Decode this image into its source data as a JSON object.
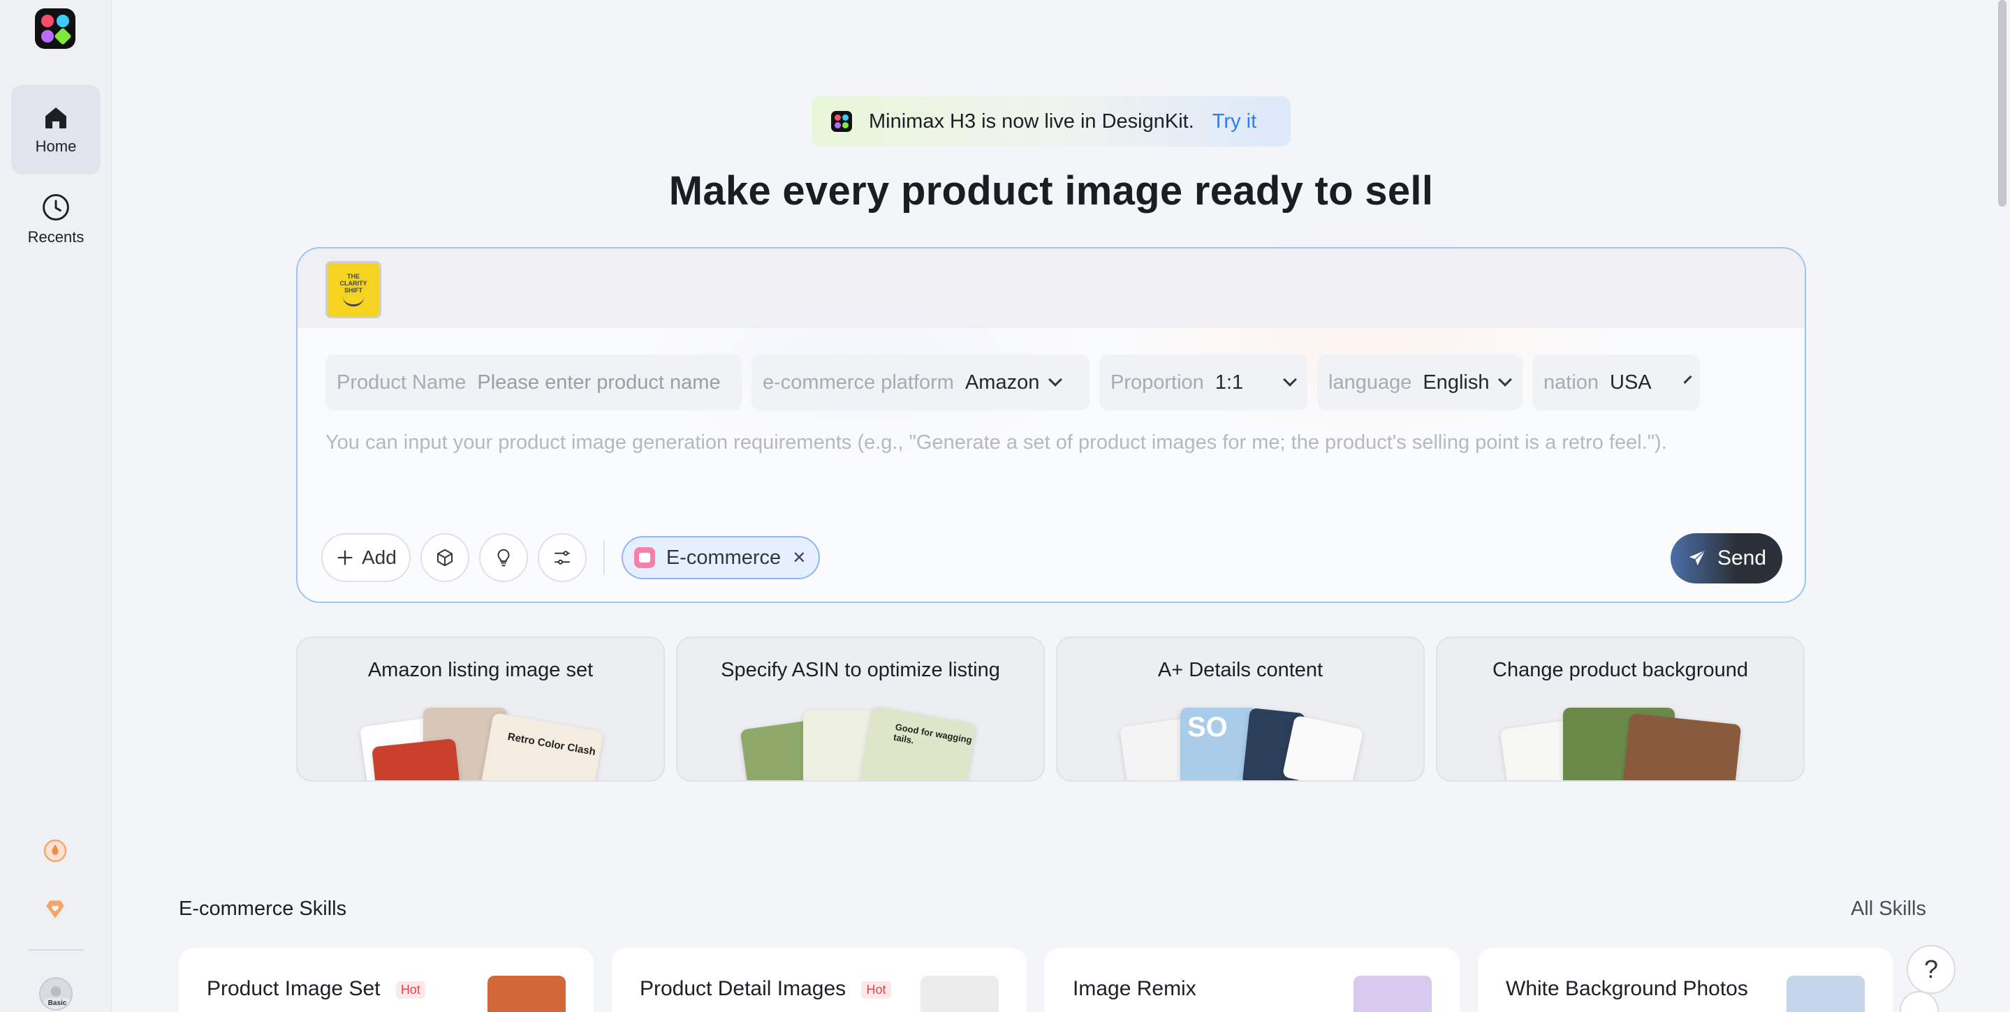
{
  "nav": {
    "home": "Home",
    "recents": "Recents",
    "avatar_badge": "Basic"
  },
  "banner": {
    "text": "Minimax H3 is now live in DesignKit.",
    "link": "Try it"
  },
  "headline": "Make every product image ready to sell",
  "card": {
    "thumbnail_text": "THE CLARITY SHIFT",
    "fields": {
      "product_name_label": "Product Name",
      "product_name_placeholder": "Please enter product name",
      "platform_label": "e-commerce platform",
      "platform_value": "Amazon",
      "proportion_label": "Proportion",
      "proportion_value": "1:1",
      "language_label": "language",
      "language_value": "English",
      "nation_label": "nation",
      "nation_value": "USA"
    },
    "requirements_placeholder": "You can input your product image generation requirements (e.g., \"Generate a set of product images for me; the product's selling point is a retro feel.\").",
    "add_label": "Add",
    "chip_label": "E-commerce",
    "send_label": "Send"
  },
  "quick_cards": [
    {
      "title": "Amazon listing image set",
      "caption": "Retro Color Clash"
    },
    {
      "title": "Specify ASIN to optimize listing",
      "caption": "Good for wagging tails."
    },
    {
      "title": "A+ Details content",
      "caption": "SO"
    },
    {
      "title": "Change product background",
      "caption": ""
    }
  ],
  "skills": {
    "title": "E-commerce Skills",
    "all_label": "All Skills",
    "items": [
      {
        "label": "Product Image Set",
        "badge": "Hot"
      },
      {
        "label": "Product Detail Images",
        "badge": "Hot"
      },
      {
        "label": "Image Remix",
        "badge": ""
      },
      {
        "label": "White Background Photos",
        "badge": ""
      }
    ]
  },
  "help_label": "?",
  "colors": {
    "accent_blue": "#2f7cf6",
    "card_border": "#9ec3f6",
    "hot_red": "#e8424a"
  }
}
